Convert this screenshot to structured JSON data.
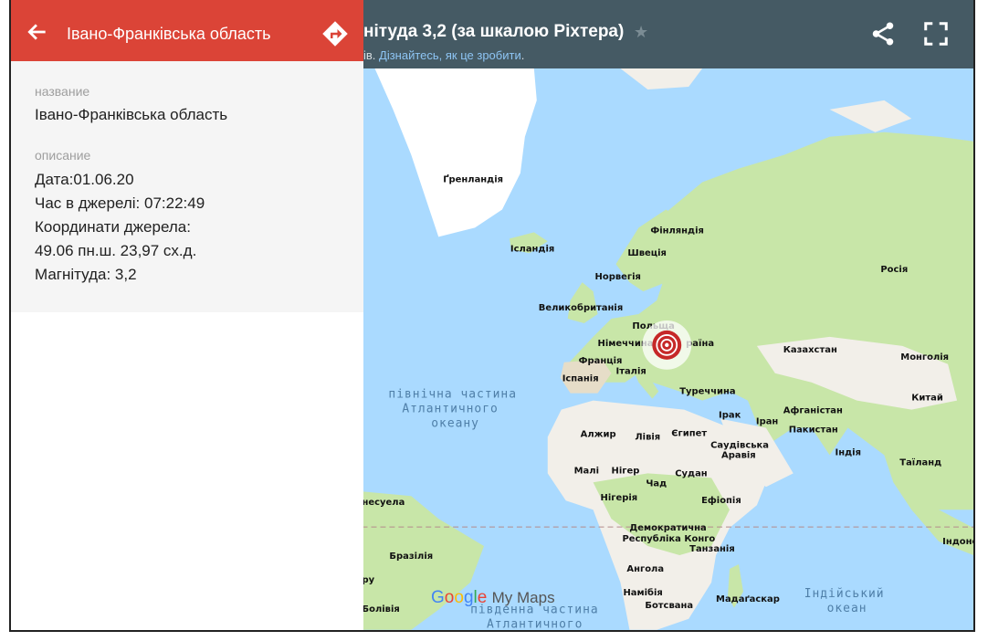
{
  "header": {
    "title": "нітуда 3,2 (за шкалою Ріхтера)",
    "subtitle_prefix": "ів.",
    "subtitle_link": "Дізнайтесь, як це зробити",
    "subtitle_suffix": "."
  },
  "panel": {
    "title": "Івано-Франківська область",
    "name_label": "название",
    "name_value": "Івано-Франківська область",
    "desc_label": "описание",
    "desc_lines": [
      "Дата:01.06.20",
      "Час в джерелі: 07:22:49",
      "Координати джерела:",
      "49.06 пн.ш. 23,97 сх.д.",
      "Магнітуда: 3,2"
    ]
  },
  "map": {
    "labels": {
      "greenland": "Ґренландія",
      "iceland": "Ісландія",
      "finland": "Фінляндія",
      "sweden": "Швеція",
      "norway": "Норвегія",
      "russia": "Росія",
      "uk": "Великобританія",
      "poland": "Польща",
      "germany": "Німеччина",
      "ukraine_partial": "раїна",
      "france": "Франція",
      "italy": "Італія",
      "spain": "Іспанія",
      "kazakhstan": "Казахстан",
      "mongolia": "Монголія",
      "turkey": "Туреччина",
      "china": "Китай",
      "afghanistan": "Афганістан",
      "pakistan": "Пакистан",
      "iraq": "Ірак",
      "iran": "Іран",
      "algeria": "Алжир",
      "libya": "Лівія",
      "egypt": "Єгипет",
      "saudi": [
        "Саудівська",
        "Аравія"
      ],
      "india": "Індія",
      "thailand": "Таїланд",
      "mali": "Малі",
      "niger": "Нігер",
      "chad": "Чад",
      "sudan": "Судан",
      "nigeria": "Нігерія",
      "ethiopia": "Ефіопія",
      "drc": [
        "Демократична",
        "Республіка Конго"
      ],
      "tanzania": "Танзанія",
      "venezuela_partial": "несуела",
      "brazil": "Бразілія",
      "angola": "Ангола",
      "namibia": "Намібія",
      "botswana": "Ботсвана",
      "madagascar": "Мадаґаскар",
      "indonesia_partial": "Індоне",
      "peru_partial": "ру",
      "bolivia_partial": "Болівія"
    },
    "oceans": {
      "north_atlantic": [
        "північна частина",
        "Атлантичного",
        "океану"
      ],
      "south_atlantic": [
        "південна частина",
        "Атлантичного"
      ],
      "indian": [
        "Індійський",
        "океан"
      ]
    },
    "marker": {
      "lat": 49.06,
      "lon": 23.97,
      "color": "#c62828"
    }
  },
  "branding": {
    "google": "Google",
    "product": "My Maps"
  },
  "colors": {
    "header_bg": "#455a64",
    "panel_header_bg": "#db4437",
    "water": "#aadaff",
    "land": "#f2efe9",
    "vegetation": "#c8e6a8"
  },
  "icons": [
    "back-arrow-icon",
    "directions-icon",
    "star-icon",
    "share-icon",
    "fullscreen-icon",
    "earthquake-marker-icon"
  ]
}
